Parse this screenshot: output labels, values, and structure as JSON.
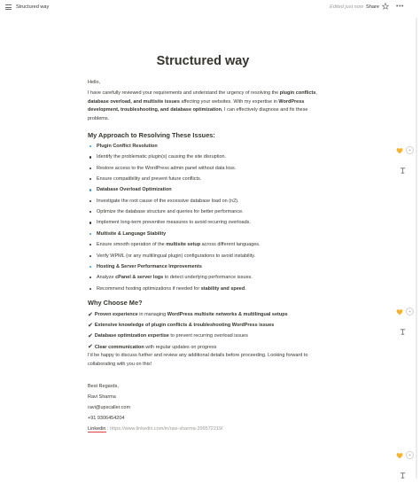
{
  "topbar": {
    "page_name": "Structured way",
    "edited": "Edited just now",
    "share": "Share"
  },
  "doc": {
    "title": "Structured way",
    "greeting": "Hello,",
    "intro": [
      {
        "t": "I have carefully reviewed your requirements and understand the urgency of resolving the ",
        "b": false
      },
      {
        "t": "plugin conflicts",
        "b": true
      },
      {
        "t": ", ",
        "b": false
      },
      {
        "t": "database overload, and multisite issues",
        "b": true
      },
      {
        "t": " affecting your websites. With my expertise in ",
        "b": false
      },
      {
        "t": "WordPress development, troubleshooting, and database optimization",
        "b": true
      },
      {
        "t": ", I can effectively diagnose and fix these problems.",
        "b": false
      }
    ],
    "approach_heading": "My Approach to Resolving These Issues:",
    "approach_items": [
      {
        "text": "Plugin Conflict Resolution",
        "type": "section"
      },
      {
        "text": "Identify the problematic plugin(s) causing the site disruption.",
        "type": "item"
      },
      {
        "text": "Restore access to the WordPress admin panel without data loss.",
        "type": "item"
      },
      {
        "text": "Ensure compatibility and prevent future conflicts.",
        "type": "item"
      },
      {
        "text": "Database Overload Optimization",
        "type": "section"
      },
      {
        "text": "Investigate the root cause of the excessive database load on (n2).",
        "type": "item"
      },
      {
        "text": "Optimize the database structure and queries for better performance.",
        "type": "item"
      },
      {
        "text": "Implement long-term preventive measures to avoid recurring overloads.",
        "type": "item"
      },
      {
        "text": "Multisite & Language Stability",
        "type": "section"
      },
      {
        "text": "Ensure smooth operation of the multisite setup across different languages.",
        "type": "item"
      },
      {
        "text": "Verify WPML (or any multilingual plugin) configurations to avoid instability.",
        "type": "item"
      },
      {
        "text": "Hosting & Server Performance Improvements",
        "type": "section"
      },
      {
        "text": "Analyze cPanel & server logs to detect underlying performance issues.",
        "type": "item"
      },
      {
        "text": "Recommend hosting optimizations if needed for stability and speed.",
        "type": "item"
      }
    ],
    "why_heading": "Why Choose Me?",
    "why_items": [
      {
        "bold": "Proven experience",
        "rest": " in managing ",
        "bold2": "WordPress multisite networks & multilingual setups",
        "rest2": ""
      },
      {
        "bold": "Extensive knowledge of plugin conflicts & troubleshooting WordPress issues",
        "rest": "",
        "bold2": "",
        "rest2": ""
      },
      {
        "bold": "Database optimization expertise",
        "rest": " to prevent recurring overload issues",
        "bold2": "",
        "rest2": ""
      },
      {
        "bold": "Clear communication",
        "rest": " with regular updates on progress",
        "bold2": "",
        "rest2": ""
      }
    ],
    "closing": "I'd be happy to discuss further and review any additional details before proceeding. Looking forward to collaborating with you on this!",
    "regards": "Best Regards,",
    "name": "Ravi Sharma",
    "email": "ravi@upscaller.com",
    "phone": "+91 9306454204",
    "linkedin_label": "Linkedin",
    "linkedin_sep": " : ",
    "linkedin_url": "https://www.linkedin.com/in/ravi-sharma-399572219/"
  },
  "icons": {
    "menu": "menu-icon",
    "star": "star-icon",
    "more": "more-icon",
    "heart": "yellow-heart-icon",
    "emoji": "add-reaction-icon",
    "comment": "comment-icon"
  },
  "colors": {
    "text": "#37352f",
    "muted": "#9b9a97",
    "bullet_blue": "#2e9bd6",
    "heart": "#f2b233",
    "link_underline": "#e03e3e"
  }
}
